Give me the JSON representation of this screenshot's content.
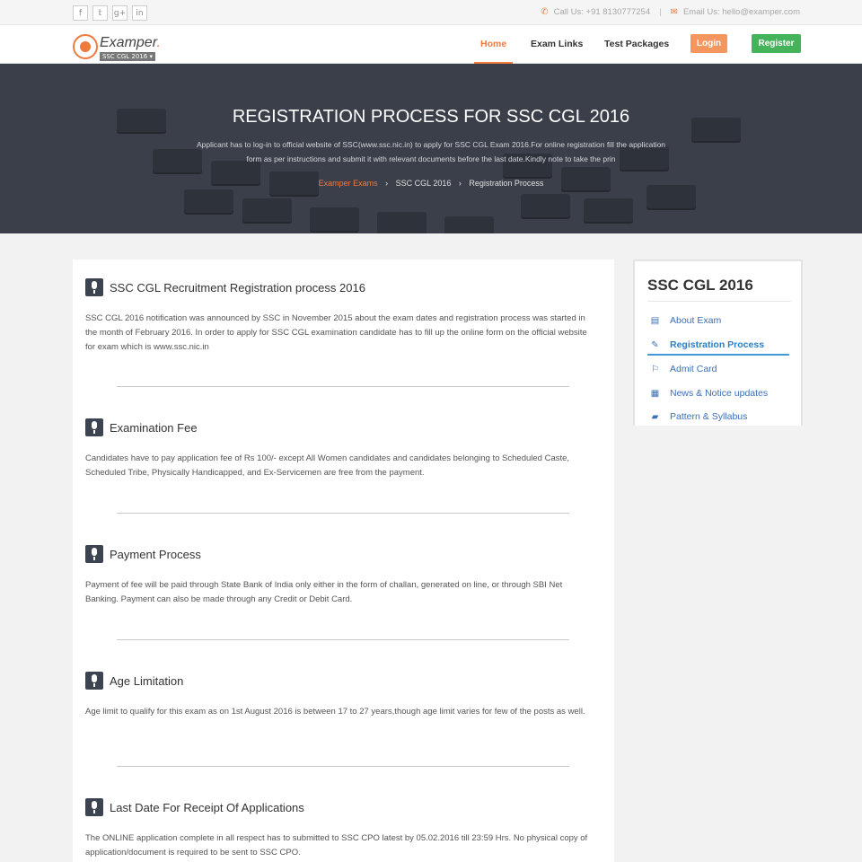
{
  "topbar": {
    "social_icons": [
      "facebook-icon",
      "twitter-icon",
      "google-plus-icon",
      "linkedin-icon"
    ],
    "social_glyphs": [
      "f",
      "𝕥",
      "g+",
      "in"
    ],
    "call": "Call Us: +91 8130777254",
    "email": "Email Us: hello@examper.com",
    "separator": "|"
  },
  "brand": {
    "name": "Examper",
    "dot": ".",
    "exam_selector": "SSC CGL 2016 ▾",
    "accent_color": "#f07a3e"
  },
  "nav": {
    "items": [
      "Home",
      "Exam Links",
      "Test Packages"
    ],
    "active": "Home",
    "login": "Login",
    "register": "Register"
  },
  "hero": {
    "title": "REGISTRATION PROCESS FOR SSC CGL 2016",
    "description": "Applicant has to log-in to official website of SSC(www.ssc.nic.in) to apply for SSC CGL Exam 2016.For online registration fill the application form as per instructions and submit it with relevant documents before the last date.Kindly note to take the prin",
    "breadcrumb": [
      "Examper Exams",
      "SSC CGL 2016",
      "Registration Process"
    ],
    "chevron": "›"
  },
  "sections": [
    {
      "title": "SSC CGL Recruitment Registration process 2016",
      "body": "SSC CGL 2016 notification was announced by SSC in November 2015 about the exam dates and registration process was started in the month of February 2016. In order to apply for SSC CGL examination candidate has to fill up the online form on the official website for exam which is www.ssc.nic.in"
    },
    {
      "title": "Examination Fee",
      "body": "Candidates have to pay application fee of Rs 100/- except All Women candidates and candidates belonging to Scheduled Caste, Scheduled Tribe, Physically Handicapped, and Ex-Servicemen are free from the payment."
    },
    {
      "title": "Payment Process",
      "body": "Payment of fee will be paid through State Bank of India only either in the form of challan, generated on line, or through SBI Net Banking. Payment can also be made through any Credit or Debit Card."
    },
    {
      "title": "Age Limitation",
      "body": "Age limit to qualify for this exam as on 1st August 2016 is between 17 to 27 years,though age limit varies for few of the posts as well."
    },
    {
      "title": "Last Date For Receipt Of Applications",
      "body": "The ONLINE application complete in all respect has to submitted to SSC CPO latest by 05.02.2016 till 23:59 Hrs. No physical copy of application/document is required to be sent to SSC CPO."
    }
  ],
  "sidebar": {
    "title": "SSC CGL 2016",
    "items": [
      {
        "label": "About Exam",
        "icon": "document-icon",
        "glyph": "▤"
      },
      {
        "label": "Registration Process",
        "icon": "edit-icon",
        "glyph": "✎"
      },
      {
        "label": "Admit Card",
        "icon": "bookmark-icon",
        "glyph": "⚐"
      },
      {
        "label": "News & Notice updates",
        "icon": "newspaper-icon",
        "glyph": "▦"
      },
      {
        "label": "Pattern & Syllabus",
        "icon": "book-icon",
        "glyph": "▰"
      }
    ],
    "active": "Registration Process"
  }
}
